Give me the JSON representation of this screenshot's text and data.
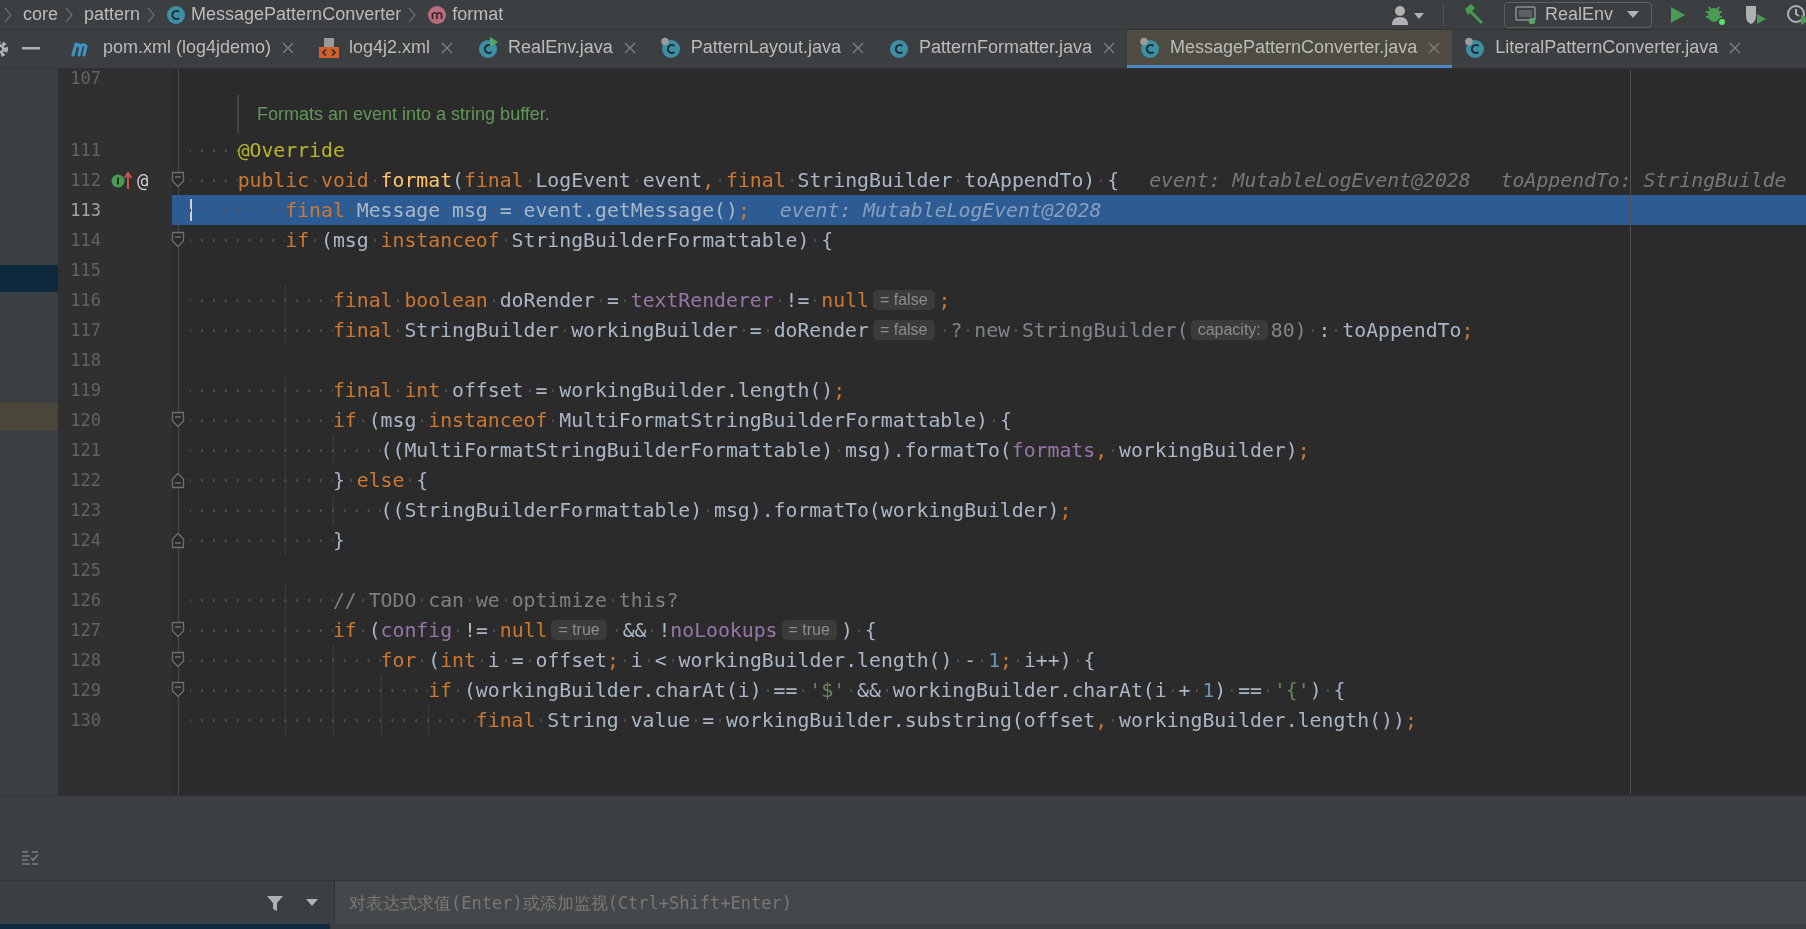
{
  "breadcrumbs": [
    {
      "kind": "folder",
      "text": "core"
    },
    {
      "kind": "folder",
      "text": "pattern"
    },
    {
      "kind": "class",
      "text": "MessagePatternConverter"
    },
    {
      "kind": "method",
      "text": "format"
    }
  ],
  "toolbar": {
    "run_config": "RealEnv"
  },
  "tabs": [
    {
      "label": "pom.xml (log4jdemo)",
      "kind": "maven",
      "selected": false
    },
    {
      "label": "log4j2.xml",
      "kind": "xml",
      "selected": false
    },
    {
      "label": "RealEnv.java",
      "kind": "class-run",
      "selected": false
    },
    {
      "label": "PatternLayout.java",
      "kind": "class-lib",
      "selected": false
    },
    {
      "label": "PatternFormatter.java",
      "kind": "class",
      "selected": false
    },
    {
      "label": "MessagePatternConverter.java",
      "kind": "class-lib",
      "selected": true
    },
    {
      "label": "LiteralPatternConverter.java",
      "kind": "class-lib",
      "selected": false
    }
  ],
  "editor": {
    "lines": [
      {
        "kind": "code",
        "number": "107",
        "execution_point": false,
        "caret": false
      },
      {
        "kind": "doc",
        "text": "Formats an event into a string buffer."
      },
      {
        "kind": "code",
        "number": "111",
        "execution_point": false,
        "caret": false,
        "tokens": [
          {
            "kind": "annotation",
            "text": "    @Override"
          }
        ]
      },
      {
        "kind": "code",
        "number": "112",
        "execution_point": false,
        "caret": false,
        "fold_marker": {
          "kind": "start"
        },
        "gutter_marks": [
          {
            "kind": "implements"
          },
          {
            "kind": "at",
            "text": "@"
          }
        ],
        "tokens": [
          {
            "kind": "keyword",
            "text": "    public void "
          },
          {
            "kind": "method",
            "text": "format"
          },
          {
            "kind": "plain",
            "text": "("
          },
          {
            "kind": "keyword",
            "text": "final "
          },
          {
            "kind": "plain",
            "text": "LogEvent event"
          },
          {
            "kind": "punct",
            "text": ", "
          },
          {
            "kind": "keyword",
            "text": "final "
          },
          {
            "kind": "plain",
            "text": "StringBuilder toAppendTo) {"
          },
          {
            "kind": "debug",
            "text": "event: MutableLogEvent@2028"
          },
          {
            "kind": "debug",
            "text": "toAppendTo: StringBuilde"
          }
        ]
      },
      {
        "kind": "code",
        "number": "113",
        "execution_point": true,
        "caret": true,
        "tokens": [
          {
            "kind": "keyword",
            "text": "        final "
          },
          {
            "kind": "plain",
            "text": "Message msg = event.getMessage()"
          },
          {
            "kind": "punct",
            "text": ";"
          },
          {
            "kind": "debug",
            "text": "event: MutableLogEvent@2028"
          }
        ]
      },
      {
        "kind": "code",
        "number": "114",
        "execution_point": false,
        "caret": false,
        "fold_marker": {
          "kind": "start"
        },
        "tokens": [
          {
            "kind": "keyword",
            "text": "        if "
          },
          {
            "kind": "plain",
            "text": "(msg "
          },
          {
            "kind": "keyword",
            "text": "instanceof "
          },
          {
            "kind": "plain",
            "text": "StringBuilderFormattable) {"
          }
        ]
      },
      {
        "kind": "code",
        "number": "115",
        "execution_point": false,
        "caret": false
      },
      {
        "kind": "code",
        "number": "116",
        "execution_point": false,
        "caret": false,
        "tokens": [
          {
            "kind": "keyword",
            "text": "            final boolean "
          },
          {
            "kind": "plain",
            "text": "doRender = "
          },
          {
            "kind": "field",
            "text": "textRenderer"
          },
          {
            "kind": "plain",
            "text": " != "
          },
          {
            "kind": "keyword",
            "text": "null"
          },
          {
            "kind": "inlay",
            "text": "= false"
          },
          {
            "kind": "punct",
            "text": ";"
          }
        ]
      },
      {
        "kind": "code",
        "number": "117",
        "execution_point": false,
        "caret": false,
        "tokens": [
          {
            "kind": "keyword",
            "text": "            final "
          },
          {
            "kind": "plain",
            "text": "StringBuilder workingBuilder = doRender"
          },
          {
            "kind": "inlay",
            "text": "= false"
          },
          {
            "kind": "dim",
            "text": " ? new StringBuilder("
          },
          {
            "kind": "param",
            "text": "capacity:"
          },
          {
            "kind": "dim",
            "text": "80)"
          },
          {
            "kind": "plain",
            "text": " : toAppendTo"
          },
          {
            "kind": "punct",
            "text": ";"
          }
        ]
      },
      {
        "kind": "code",
        "number": "118",
        "execution_point": false,
        "caret": false
      },
      {
        "kind": "code",
        "number": "119",
        "execution_point": false,
        "caret": false,
        "tokens": [
          {
            "kind": "keyword",
            "text": "            final int "
          },
          {
            "kind": "plain",
            "text": "offset = workingBuilder.length()"
          },
          {
            "kind": "punct",
            "text": ";"
          }
        ]
      },
      {
        "kind": "code",
        "number": "120",
        "execution_point": false,
        "caret": false,
        "fold_marker": {
          "kind": "start"
        },
        "tokens": [
          {
            "kind": "keyword",
            "text": "            if "
          },
          {
            "kind": "plain",
            "text": "(msg "
          },
          {
            "kind": "keyword",
            "text": "instanceof "
          },
          {
            "kind": "plain",
            "text": "MultiFormatStringBuilderFormattable) {"
          }
        ]
      },
      {
        "kind": "code",
        "number": "121",
        "execution_point": false,
        "caret": false,
        "tokens": [
          {
            "kind": "plain",
            "text": "                ((MultiFormatStringBuilderFormattable) msg).formatTo("
          },
          {
            "kind": "field",
            "text": "formats"
          },
          {
            "kind": "punct",
            "text": ", "
          },
          {
            "kind": "plain",
            "text": "workingBuilder)"
          },
          {
            "kind": "punct",
            "text": ";"
          }
        ]
      },
      {
        "kind": "code",
        "number": "122",
        "execution_point": false,
        "caret": false,
        "fold_marker": {
          "kind": "end"
        },
        "tokens": [
          {
            "kind": "plain",
            "text": "            } "
          },
          {
            "kind": "keyword",
            "text": "else "
          },
          {
            "kind": "plain",
            "text": "{"
          }
        ]
      },
      {
        "kind": "code",
        "number": "123",
        "execution_point": false,
        "caret": false,
        "tokens": [
          {
            "kind": "plain",
            "text": "                ((StringBuilderFormattable) msg).formatTo(workingBuilder)"
          },
          {
            "kind": "punct",
            "text": ";"
          }
        ]
      },
      {
        "kind": "code",
        "number": "124",
        "execution_point": false,
        "caret": false,
        "fold_marker": {
          "kind": "end"
        },
        "tokens": [
          {
            "kind": "plain",
            "text": "            }"
          }
        ]
      },
      {
        "kind": "code",
        "number": "125",
        "execution_point": false,
        "caret": false
      },
      {
        "kind": "code",
        "number": "126",
        "execution_point": false,
        "caret": false,
        "tokens": [
          {
            "kind": "comment",
            "text": "            // TODO can we optimize this?"
          }
        ]
      },
      {
        "kind": "code",
        "number": "127",
        "execution_point": false,
        "caret": false,
        "fold_marker": {
          "kind": "start"
        },
        "tokens": [
          {
            "kind": "keyword",
            "text": "            if "
          },
          {
            "kind": "plain",
            "text": "("
          },
          {
            "kind": "field",
            "text": "config"
          },
          {
            "kind": "plain",
            "text": " != "
          },
          {
            "kind": "keyword",
            "text": "null"
          },
          {
            "kind": "inlay",
            "text": "= true"
          },
          {
            "kind": "plain",
            "text": " && !"
          },
          {
            "kind": "field",
            "text": "noLookups"
          },
          {
            "kind": "inlay",
            "text": "= true"
          },
          {
            "kind": "plain",
            "text": ") {"
          }
        ]
      },
      {
        "kind": "code",
        "number": "128",
        "execution_point": false,
        "caret": false,
        "fold_marker": {
          "kind": "start"
        },
        "tokens": [
          {
            "kind": "keyword",
            "text": "                for "
          },
          {
            "kind": "plain",
            "text": "("
          },
          {
            "kind": "keyword",
            "text": "int "
          },
          {
            "kind": "plain",
            "text": "i = offset"
          },
          {
            "kind": "punct",
            "text": "; "
          },
          {
            "kind": "plain",
            "text": "i < workingBuilder.length() - "
          },
          {
            "kind": "number",
            "text": "1"
          },
          {
            "kind": "punct",
            "text": "; "
          },
          {
            "kind": "plain",
            "text": "i++) {"
          }
        ]
      },
      {
        "kind": "code",
        "number": "129",
        "execution_point": false,
        "caret": false,
        "fold_marker": {
          "kind": "start"
        },
        "tokens": [
          {
            "kind": "keyword",
            "text": "                    if "
          },
          {
            "kind": "plain",
            "text": "(workingBuilder.charAt(i) == "
          },
          {
            "kind": "string",
            "text": "'$'"
          },
          {
            "kind": "plain",
            "text": " && workingBuilder.charAt(i + "
          },
          {
            "kind": "number",
            "text": "1"
          },
          {
            "kind": "plain",
            "text": ") == "
          },
          {
            "kind": "string",
            "text": "'{'"
          },
          {
            "kind": "plain",
            "text": ") {"
          }
        ]
      },
      {
        "kind": "code",
        "number": "130",
        "execution_point": false,
        "caret": false,
        "tokens": [
          {
            "kind": "keyword",
            "text": "                        final "
          },
          {
            "kind": "plain",
            "text": "String value = workingBuilder.substring(offset"
          },
          {
            "kind": "punct",
            "text": ", "
          },
          {
            "kind": "plain",
            "text": "workingBuilder.length())"
          },
          {
            "kind": "punct",
            "text": ";"
          }
        ]
      }
    ]
  },
  "debugger": {
    "expression_field": {
      "placeholder": "对表达式求值(Enter)或添加监视(Ctrl+Shift+Enter)"
    }
  }
}
